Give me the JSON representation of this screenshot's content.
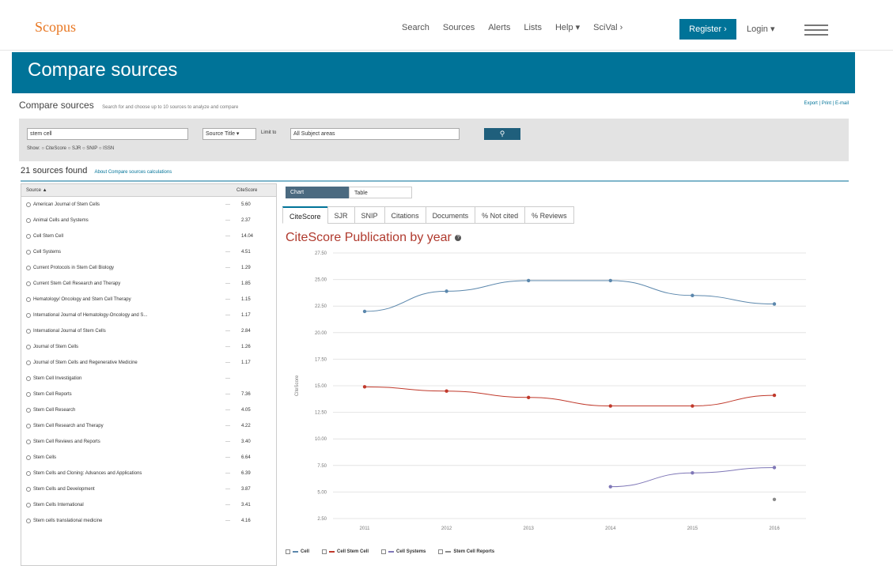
{
  "app": {
    "logo": "Scopus"
  },
  "nav": {
    "items": [
      "Search",
      "Sources",
      "Alerts",
      "Lists",
      "Help ▾",
      "SciVal ›"
    ],
    "register": "Register ›",
    "login": "Login ▾"
  },
  "banner": {
    "title": "Compare sources"
  },
  "subheader": {
    "title": "Compare sources",
    "description": "Search for and choose up to 10 sources to analyze and compare",
    "export": "Export",
    "print": "Print",
    "email": "E-mail"
  },
  "search": {
    "query": "stem cell",
    "type": "Source Title ▾",
    "limit_label": "Limit to",
    "subject": "All Subject areas",
    "radios_label": "Show:",
    "radios": [
      "CiteScore",
      "SJR",
      "SNIP",
      "ISSN"
    ]
  },
  "results": {
    "count": "21",
    "label": "sources found",
    "link": "About Compare sources calculations"
  },
  "list": {
    "header_source": "Source ▲",
    "header_score": "CiteScore",
    "rows": [
      {
        "name": "American Journal of Stem Cells",
        "score": "5.60"
      },
      {
        "name": "Animal Cells and Systems",
        "score": "2.37"
      },
      {
        "name": "Cell Stem Cell",
        "score": "14.04"
      },
      {
        "name": "Cell Systems",
        "score": "4.51"
      },
      {
        "name": "Current Protocols in Stem Cell Biology",
        "score": "1.29"
      },
      {
        "name": "Current Stem Cell Research and Therapy",
        "score": "1.85"
      },
      {
        "name": "Hematology/ Oncology and Stem Cell Therapy",
        "score": "1.15"
      },
      {
        "name": "International Journal of Hematology-Oncology and S...",
        "score": "1.17"
      },
      {
        "name": "International Journal of Stem Cells",
        "score": "2.84"
      },
      {
        "name": "Journal of Stem Cells",
        "score": "1.26"
      },
      {
        "name": "Journal of Stem Cells and Regenerative Medicine",
        "score": "1.17"
      },
      {
        "name": "Stem Cell Investigation",
        "score": ""
      },
      {
        "name": "Stem Cell Reports",
        "score": "7.36"
      },
      {
        "name": "Stem Cell Research",
        "score": "4.05"
      },
      {
        "name": "Stem Cell Research and Therapy",
        "score": "4.22"
      },
      {
        "name": "Stem Cell Reviews and Reports",
        "score": "3.40"
      },
      {
        "name": "Stem Cells",
        "score": "6.64"
      },
      {
        "name": "Stem Cells and Cloning: Advances and Applications",
        "score": "6.39"
      },
      {
        "name": "Stem Cells and Development",
        "score": "3.87"
      },
      {
        "name": "Stem Cells International",
        "score": "3.41"
      },
      {
        "name": "Stem cells translational medicine",
        "score": "4.16"
      }
    ]
  },
  "view": {
    "chart": "Chart",
    "table": "Table"
  },
  "metric_tabs": [
    "CiteScore",
    "SJR",
    "SNIP",
    "Citations",
    "Documents",
    "% Not cited",
    "% Reviews"
  ],
  "chart_title": "CiteScore Publication by year",
  "chart_data": {
    "type": "line",
    "title": "CiteScore Publication by year",
    "xlabel": "",
    "ylabel": "CiteScore",
    "x": [
      "2011",
      "2012",
      "2013",
      "2014",
      "2015",
      "2016"
    ],
    "ylim": [
      2.5,
      27.5
    ],
    "yticks": [
      "2.50",
      "5.00",
      "7.50",
      "10.00",
      "12.50",
      "15.00",
      "17.50",
      "20.00",
      "22.50",
      "25.00",
      "27.50"
    ],
    "grid": true,
    "legend": "bottom",
    "series": [
      {
        "name": "Cell",
        "color": "#5b87ac",
        "values": [
          22.0,
          23.9,
          24.9,
          24.9,
          23.5,
          22.7
        ]
      },
      {
        "name": "Cell Stem Cell",
        "color": "#c0392b",
        "values": [
          14.9,
          14.5,
          13.9,
          13.1,
          13.1,
          14.1
        ]
      },
      {
        "name": "Cell Systems",
        "color": "#7f77b7",
        "values": [
          null,
          null,
          null,
          5.5,
          6.8,
          7.3
        ]
      },
      {
        "name": "Stem Cell Reports",
        "color": "#8a8a8a",
        "values": [
          null,
          null,
          null,
          null,
          null,
          4.3
        ]
      }
    ]
  }
}
